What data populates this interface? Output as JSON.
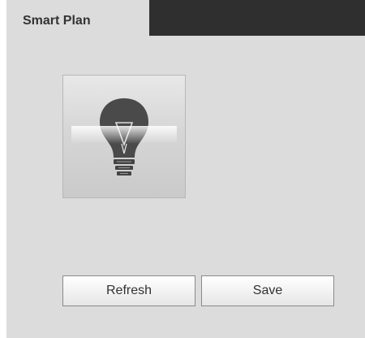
{
  "tabs": [
    {
      "label": "Smart Plan",
      "active": true
    }
  ],
  "plans": [
    {
      "icon": "lightbulb-icon"
    }
  ],
  "actions": {
    "refresh_label": "Refresh",
    "save_label": "Save"
  },
  "colors": {
    "panel_background": "#dcdcdc",
    "tab_bar_dark": "#2f2f2f",
    "text": "#333333"
  }
}
